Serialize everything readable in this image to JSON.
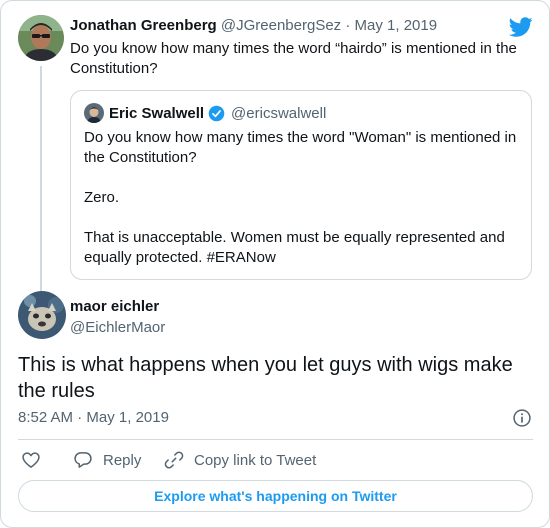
{
  "parent_tweet": {
    "display_name": "Jonathan Greenberg",
    "handle": "@JGreenbergSez",
    "separator": "·",
    "date": "May 1, 2019",
    "text": "Do you know how many times the word “hairdo” is mentioned in the Constitution?"
  },
  "quoted_tweet": {
    "display_name": "Eric Swalwell",
    "handle": "@ericswalwell",
    "text": "Do you know how many times the word \"Woman\" is mentioned in the Constitution?\n\nZero.\n\nThat is unacceptable. Women must be equally represented and equally protected. #ERANow"
  },
  "main_tweet": {
    "display_name": "maor eichler",
    "handle": "@EichlerMaor",
    "text": "This is what happens when you let guys with wigs make the rules",
    "time": "8:52 AM",
    "separator": "·",
    "date": "May 1, 2019"
  },
  "actions": {
    "reply_label": "Reply",
    "copy_link_label": "Copy link to Tweet"
  },
  "footer": {
    "explore_label": "Explore what's happening on Twitter"
  },
  "colors": {
    "brand_blue": "#1d9bf0",
    "muted_text": "#536471",
    "border": "#cfd9de"
  },
  "icons": [
    "twitter-bird-icon",
    "verified-badge-icon",
    "info-icon",
    "heart-icon",
    "reply-icon",
    "link-icon"
  ]
}
